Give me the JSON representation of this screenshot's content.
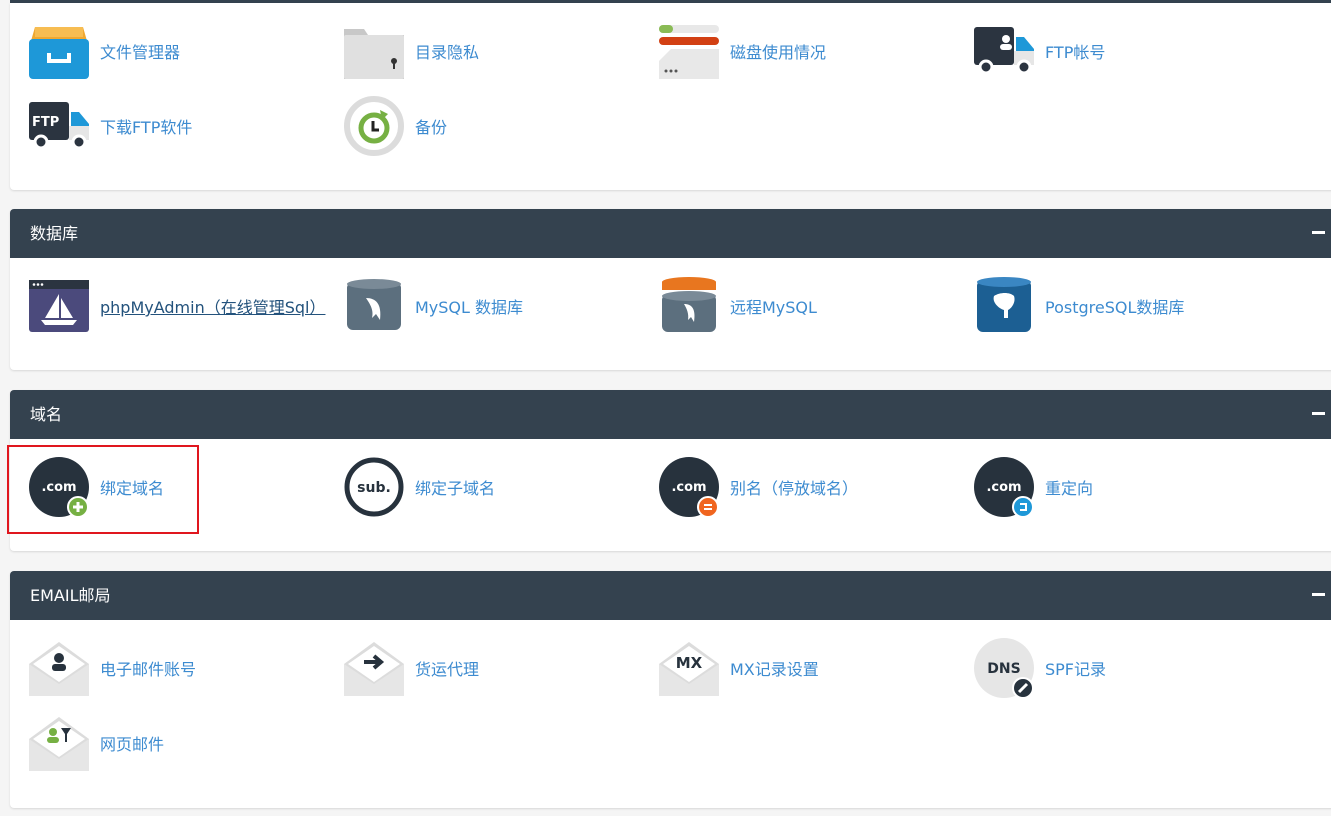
{
  "sections": [
    {
      "title": null,
      "items": [
        {
          "label": "文件管理器",
          "icon": "file-manager-icon"
        },
        {
          "label": "目录隐私",
          "icon": "directory-privacy-icon"
        },
        {
          "label": "磁盘使用情况",
          "icon": "disk-usage-icon"
        },
        {
          "label": "FTP帐号",
          "icon": "ftp-account-icon"
        },
        {
          "label": "下载FTP软件",
          "icon": "ftp-truck-icon"
        },
        {
          "label": "备份",
          "icon": "backup-icon"
        }
      ]
    },
    {
      "title": "数据库",
      "items": [
        {
          "label": "phpMyAdmin（在线管理Sql）",
          "icon": "phpmyadmin-icon"
        },
        {
          "label": "MySQL 数据库",
          "icon": "mysql-icon"
        },
        {
          "label": "远程MySQL",
          "icon": "remote-mysql-icon"
        },
        {
          "label": "PostgreSQL数据库",
          "icon": "postgresql-icon"
        }
      ]
    },
    {
      "title": "域名",
      "items": [
        {
          "label": "绑定域名",
          "icon": "addon-domain-icon"
        },
        {
          "label": "绑定子域名",
          "icon": "subdomain-icon"
        },
        {
          "label": "别名（停放域名）",
          "icon": "alias-domain-icon"
        },
        {
          "label": "重定向",
          "icon": "redirect-icon"
        }
      ]
    },
    {
      "title": "EMAIL邮局",
      "items": [
        {
          "label": "电子邮件账号",
          "icon": "email-account-icon"
        },
        {
          "label": "货运代理",
          "icon": "forwarder-icon"
        },
        {
          "label": "MX记录设置",
          "icon": "mx-record-icon"
        },
        {
          "label": "SPF记录",
          "icon": "spf-record-icon"
        },
        {
          "label": "网页邮件",
          "icon": "webmail-icon"
        }
      ]
    }
  ],
  "icon_text": {
    "com": ".com",
    "sub": "sub.",
    "ftp": "FTP",
    "mx": "MX",
    "dns": "DNS"
  },
  "colors": {
    "header": "#34424f",
    "link": "#3d8bd0",
    "highlight": "#e0161e"
  }
}
